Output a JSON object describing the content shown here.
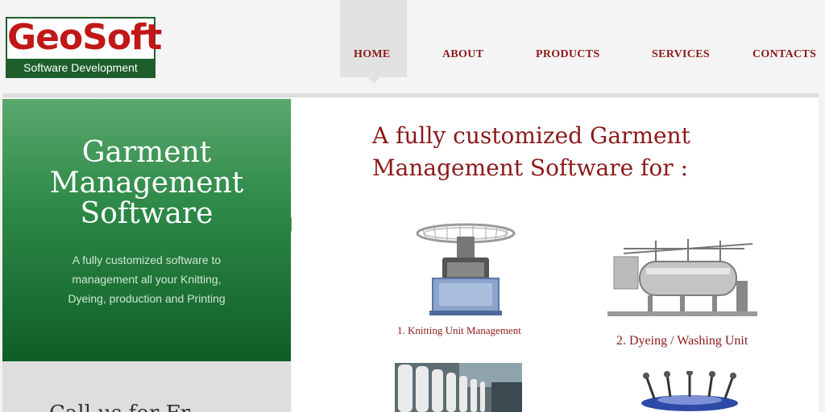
{
  "brand": {
    "name": "GeoSoft",
    "tagline": "Software Development"
  },
  "nav": {
    "items": [
      "HOME",
      "ABOUT",
      "PRODUCTS",
      "SERVICES",
      "CONTACTS"
    ],
    "active": "HOME"
  },
  "hero": {
    "title_lines": [
      "Garment",
      "Management",
      "Software"
    ],
    "description_lines": [
      "A fully customized software to",
      "management all your Knitting,",
      "Dyeing, production and Printing"
    ],
    "lower_text": "Call us for Fr"
  },
  "main": {
    "heading_lines": [
      "A fully customized Garment",
      "Management Software for :"
    ],
    "items": [
      {
        "caption": "1. Knitting Unit Management",
        "icon": "knitting-machine-image"
      },
      {
        "caption": "2. Dyeing / Washing Unit",
        "icon": "dyeing-machine-image"
      },
      {
        "caption": "",
        "icon": "yarn-spinning-image"
      },
      {
        "caption": "",
        "icon": "printing-machine-image"
      }
    ]
  },
  "colors": {
    "accent_red": "#8b1a1a",
    "logo_red": "#c01818",
    "brand_green": "#1d5e2c",
    "panel_green_top": "#5aa86d",
    "panel_green_bottom": "#0f5e25"
  }
}
